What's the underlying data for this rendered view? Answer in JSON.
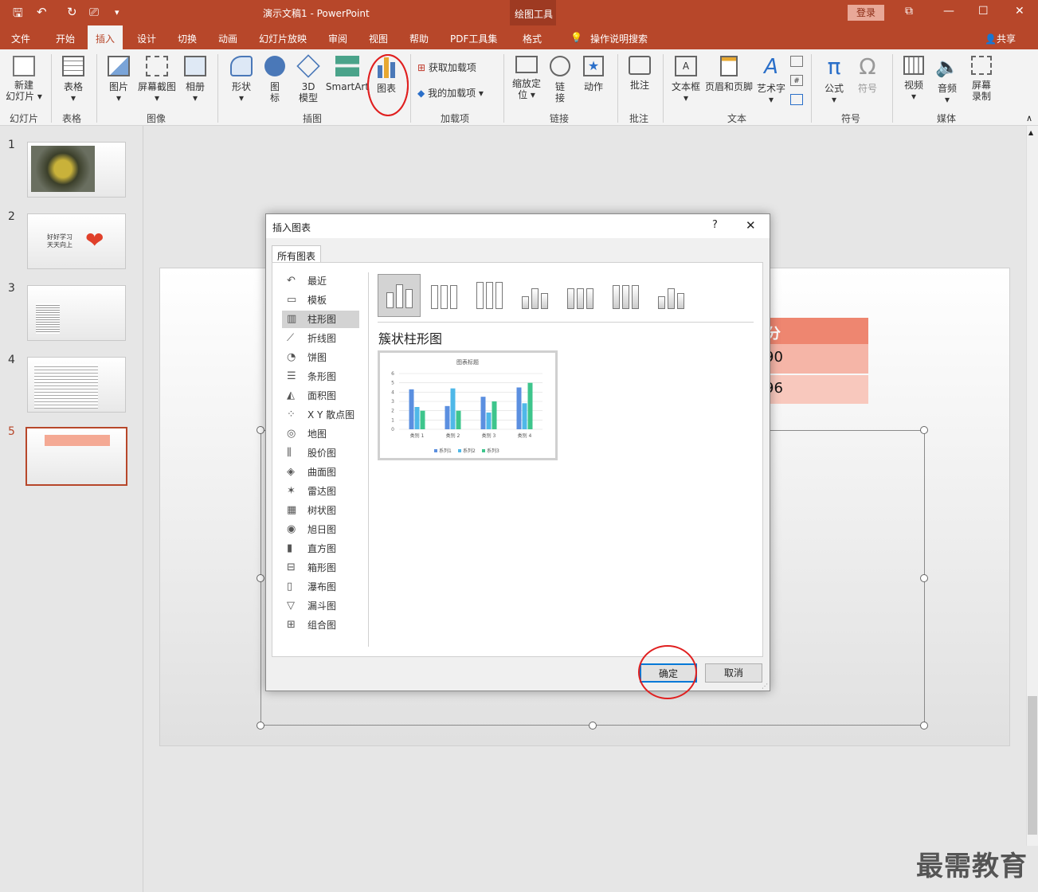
{
  "window": {
    "doc_title": "演示文稿1  -  PowerPoint",
    "context_tool": "绘图工具",
    "login": "登录",
    "share": "共享"
  },
  "tabs": [
    "文件",
    "开始",
    "插入",
    "设计",
    "切换",
    "动画",
    "幻灯片放映",
    "审阅",
    "视图",
    "帮助",
    "PDF工具集",
    "格式"
  ],
  "active_tab": "插入",
  "tell_me": "操作说明搜索",
  "ribbon": {
    "new_slide": "新建",
    "new_slide2": "幻灯片",
    "table": "表格",
    "picture": "图片",
    "screenshot": "屏幕截图",
    "album": "相册",
    "shapes": "形状",
    "icons1": "图",
    "icons2": "标",
    "model1": "3D",
    "model2": "模型",
    "smartart": "SmartArt",
    "chart": "图表",
    "get_addins": "获取加载项",
    "my_addins": "我的加载项",
    "zoom1": "缩放定",
    "zoom2": "位",
    "link1": "链",
    "link2": "接",
    "action": "动作",
    "comment": "批注",
    "textbox": "文本框",
    "header_footer": "页眉和页脚",
    "wordart": "艺术字",
    "equation": "公式",
    "symbol": "符号",
    "video": "视频",
    "audio": "音频",
    "screenrec1": "屏幕",
    "screenrec2": "录制",
    "groups": {
      "slides": "幻灯片",
      "tables": "表格",
      "images": "图像",
      "illustrations": "插图",
      "addins": "加载项",
      "links": "链接",
      "comments": "批注",
      "text": "文本",
      "symbols": "符号",
      "media": "媒体"
    }
  },
  "slides": [
    {
      "num": "1"
    },
    {
      "num": "2",
      "text1": "好好学习",
      "text2": "天天向上"
    },
    {
      "num": "3"
    },
    {
      "num": "4"
    },
    {
      "num": "5"
    }
  ],
  "slide_table": {
    "header": "分",
    "row1": "90",
    "row2": "96"
  },
  "dialog": {
    "title": "插入图表",
    "help": "?",
    "close": "✕",
    "tab": "所有图表",
    "categories": [
      "最近",
      "模板",
      "柱形图",
      "折线图",
      "饼图",
      "条形图",
      "面积图",
      "X Y 散点图",
      "地图",
      "股价图",
      "曲面图",
      "雷达图",
      "树状图",
      "旭日图",
      "直方图",
      "箱形图",
      "瀑布图",
      "漏斗图",
      "组合图"
    ],
    "selected_category": "柱形图",
    "subtype_title": "簇状柱形图",
    "ok": "确定",
    "cancel": "取消"
  },
  "chart_data": {
    "type": "bar",
    "title": "图表标题",
    "categories": [
      "类别 1",
      "类别 2",
      "类别 3",
      "类别 4"
    ],
    "series": [
      {
        "name": "系列1",
        "values": [
          4.3,
          2.5,
          3.5,
          4.5
        ]
      },
      {
        "name": "系列2",
        "values": [
          2.4,
          4.4,
          1.8,
          2.8
        ]
      },
      {
        "name": "系列3",
        "values": [
          2,
          2,
          3,
          5
        ]
      }
    ],
    "ylim": [
      0,
      6
    ],
    "yticks": [
      "0",
      "1",
      "2",
      "3",
      "4",
      "5",
      "6"
    ],
    "colors": [
      "#5b8fe0",
      "#4fb8e8",
      "#3ec58c"
    ],
    "legend": "bottom"
  },
  "watermark": "最需教育"
}
